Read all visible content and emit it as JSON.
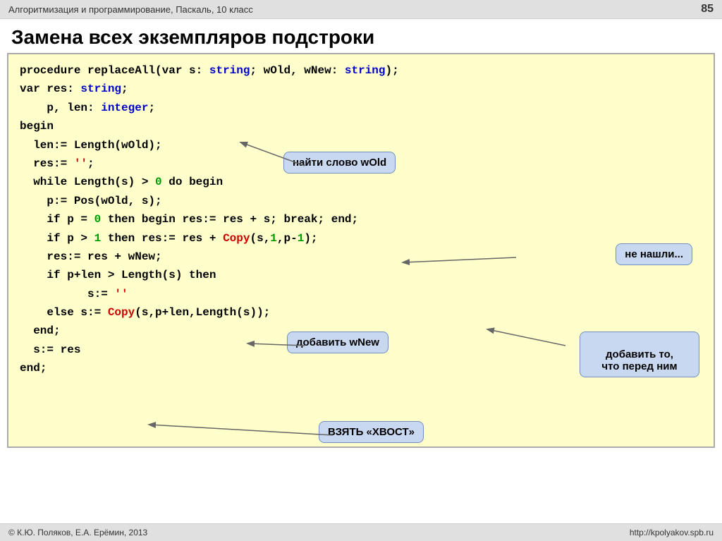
{
  "header": {
    "title": "Алгоритмизация и программирование, Паскаль, 10 класс",
    "page": "85"
  },
  "main_title": "Замена всех экземпляров подстроки",
  "code_lines": [
    {
      "id": "line1",
      "html": "<span class='kw'>procedure</span> <span style='color:#000'>replaceAll</span>(<span class='kw'>var</span> s: <span class='type'>string</span>; wOld, wNew: <span class='type'>string</span>);"
    },
    {
      "id": "line2",
      "html": "<span class='kw'>var</span> res: <span class='type'>string</span>;"
    },
    {
      "id": "line3",
      "html": "&nbsp;&nbsp;&nbsp;&nbsp;p, len: <span class='type'>integer</span>;"
    },
    {
      "id": "line4",
      "html": "<span class='kw'>begin</span>"
    },
    {
      "id": "line5",
      "html": "&nbsp;&nbsp;len:= Length(wOld);"
    },
    {
      "id": "line6",
      "html": "&nbsp;&nbsp;res:= <span style='color:#cc0000'>''</span>;"
    },
    {
      "id": "line7",
      "html": "&nbsp;&nbsp;<span class='kw'>while</span> Length(s) &gt; <span class='num'>0</span> <span class='kw'>do</span> <span class='kw'>begin</span>"
    },
    {
      "id": "line8",
      "html": "&nbsp;&nbsp;&nbsp;&nbsp;p:= Pos(wOld, s);"
    },
    {
      "id": "line9",
      "html": "&nbsp;&nbsp;&nbsp;&nbsp;<span class='kw'>if</span> p = <span class='num'>0</span> <span class='kw'>then</span> <span class='kw'>begin</span> res:= res + s; <span class='kw'>break</span>; <span class='kw'>end</span>;"
    },
    {
      "id": "line10",
      "html": "&nbsp;&nbsp;&nbsp;&nbsp;<span class='kw'>if</span> p &gt; <span class='num'>1</span> <span class='kw'>then</span> res:= res + <span style='color:#cc0000'>Copy</span>(s,<span class='num'>1</span>,p-<span class='num'>1</span>);"
    },
    {
      "id": "line11",
      "html": "&nbsp;&nbsp;&nbsp;&nbsp;res:= res + wNew;"
    },
    {
      "id": "line12",
      "html": "&nbsp;&nbsp;&nbsp;&nbsp;<span class='kw'>if</span> p+len &gt; Length(s) <span class='kw'>then</span>"
    },
    {
      "id": "line13",
      "html": "&nbsp;&nbsp;&nbsp;&nbsp;&nbsp;&nbsp;&nbsp;&nbsp;&nbsp;&nbsp;s:= <span style='color:#cc0000'>''</span>"
    },
    {
      "id": "line14",
      "html": "&nbsp;&nbsp;&nbsp;&nbsp;<span class='kw'>else</span> s:= <span style='color:#cc0000'>Copy</span>(s,p+len,Length(s));"
    },
    {
      "id": "line15",
      "html": "&nbsp;&nbsp;<span class='kw'>end</span>;"
    },
    {
      "id": "line16",
      "html": "&nbsp;&nbsp;s:= res"
    },
    {
      "id": "line17",
      "html": "<span class='kw'>end</span>;"
    }
  ],
  "bubbles": {
    "nayti": "найти слово wOld",
    "ne_nashli": "не нашли...",
    "dobavit_wnew": "добавить wNew",
    "dobavit_to": "добавить то,\nчто перед ним",
    "vzyat": "ВЗЯТЬ «ХВОСТ»"
  },
  "footer": {
    "left": "© К.Ю. Поляков, Е.А. Ерёмин, 2013",
    "right": "http://kpolyakov.spb.ru"
  }
}
